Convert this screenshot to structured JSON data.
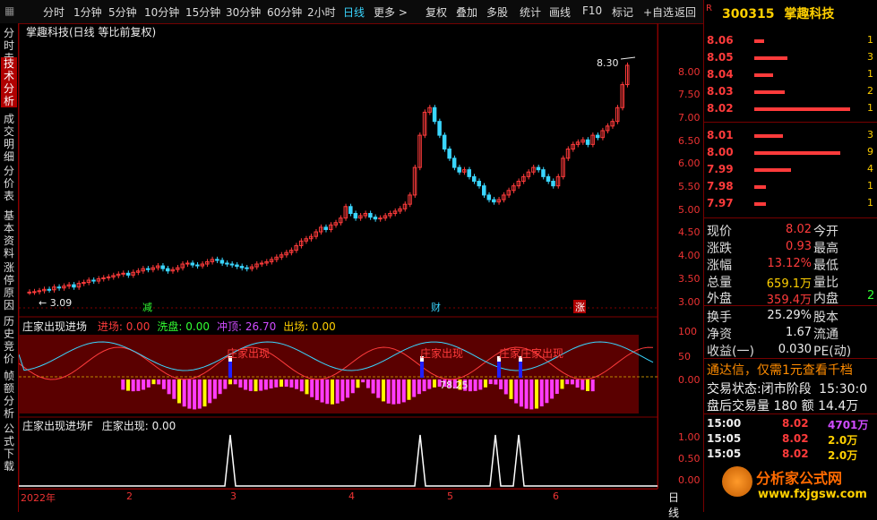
{
  "toolbar": {
    "items": [
      "分时",
      "1分钟",
      "5分钟",
      "10分钟",
      "15分钟",
      "30分钟",
      "60分钟",
      "2小时",
      "日线",
      "更多 >",
      "复权",
      "叠加",
      "多股",
      "统计",
      "画线",
      "F10",
      "标记",
      "+自选",
      "返回"
    ],
    "active": "日线"
  },
  "left_tabs": [
    "分时走势",
    "技术分析",
    "成交明细",
    "分价表",
    "基本资料",
    "涨停原因",
    "历史竞价",
    "帧额分析",
    "公式下载"
  ],
  "main_chart": {
    "title": "掌趣科技(日线 等比前复权)",
    "high_label": "8.30",
    "low_label": "3.09",
    "markers": [
      "减",
      "财",
      "涨"
    ],
    "y_ticks": [
      "8.00",
      "7.50",
      "7.00",
      "6.50",
      "6.00",
      "5.50",
      "5.00",
      "4.50",
      "4.00",
      "3.50",
      "3.00"
    ]
  },
  "indicator1": {
    "name": "庄家出现进场",
    "vals": [
      {
        "label": "进场: 0.00",
        "color": "#ff3b3b"
      },
      {
        "label": "洗盘: 0.00",
        "color": "#33ff33"
      },
      {
        "label": "冲顶: 26.70",
        "color": "#d04cff"
      },
      {
        "label": "出场: 0.00",
        "color": "#ffd000"
      }
    ],
    "annot": [
      "庄家出现",
      "庄家出现",
      "庄家庄家出现"
    ],
    "value_label": "78.25",
    "y_ticks": [
      "100",
      "50",
      "0.00"
    ]
  },
  "indicator2": {
    "name": "庄家出现进场F",
    "val": "庄家出现: 0.00",
    "y_ticks": [
      "1.00",
      "0.50",
      "0.00"
    ]
  },
  "time_axis": {
    "labels": [
      "2022年",
      "2",
      "3",
      "4",
      "5",
      "6"
    ],
    "period": "日线"
  },
  "quote": {
    "code": "300315",
    "name": "掌趣科技",
    "badge": "R",
    "sell": [
      {
        "price": "8.06",
        "bar": 0.1,
        "vol": "1"
      },
      {
        "price": "8.05",
        "bar": 0.35,
        "vol": "3"
      },
      {
        "price": "8.04",
        "bar": 0.2,
        "vol": "1"
      },
      {
        "price": "8.03",
        "bar": 0.32,
        "vol": "2"
      },
      {
        "price": "8.02",
        "bar": 1.0,
        "vol": "1"
      }
    ],
    "buy": [
      {
        "price": "8.01",
        "bar": 0.3,
        "vol": "3"
      },
      {
        "price": "8.00",
        "bar": 0.9,
        "vol": "9"
      },
      {
        "price": "7.99",
        "bar": 0.38,
        "vol": "4"
      },
      {
        "price": "7.98",
        "bar": 0.12,
        "vol": "1"
      },
      {
        "price": "7.97",
        "bar": 0.12,
        "vol": "1"
      }
    ],
    "stats": [
      {
        "label": "现价",
        "value": "8.02",
        "vcolor": "#ff3b3b",
        "right": "今开"
      },
      {
        "label": "涨跌",
        "value": "0.93",
        "vcolor": "#ff3b3b",
        "right": "最高"
      },
      {
        "label": "涨幅",
        "value": "13.12%",
        "vcolor": "#ff3b3b",
        "right": "最低"
      },
      {
        "label": "总量",
        "value": "659.1万",
        "vcolor": "#ffd000",
        "right": "量比"
      },
      {
        "label": "外盘",
        "value": "359.4万",
        "vcolor": "#ff3b3b",
        "right": "内盘"
      }
    ],
    "stats2": [
      {
        "label": "换手",
        "value": "25.29%",
        "vcolor": "#eeeeee",
        "right": "股本"
      },
      {
        "label": "净资",
        "value": "1.67",
        "vcolor": "#eeeeee",
        "right": "流通"
      },
      {
        "label": "收益(一)",
        "value": "0.030",
        "vcolor": "#eeeeee",
        "right": "PE(动)"
      }
    ],
    "inner_val": "2",
    "promo": "通达信，仅需1元查看千档",
    "trade_state_label": "交易状态:",
    "trade_state": "闭市阶段",
    "trade_time": "15:30:0",
    "after_label": "盘后交易量",
    "after_vol": "180",
    "after_amt_label": "额",
    "after_amt": "14.4万",
    "ticks": [
      {
        "time": "15:00",
        "price": "8.02",
        "vol": "4701万",
        "vcolor": "#d04cff"
      },
      {
        "time": "15:05",
        "price": "8.02",
        "vol": "2.0万",
        "vcolor": "#ffd000"
      },
      {
        "time": "15:05",
        "price": "8.02",
        "vol": "2.0万",
        "vcolor": "#ffd000"
      }
    ],
    "logo": "分析家公式网",
    "logo_url": "www.fxjgsw.com"
  },
  "colors": {
    "up": "#ff3b3b",
    "down": "#3ad6ff",
    "grid": "#800000",
    "magenta": "#ff3cff",
    "yellow": "#ffff00"
  }
}
